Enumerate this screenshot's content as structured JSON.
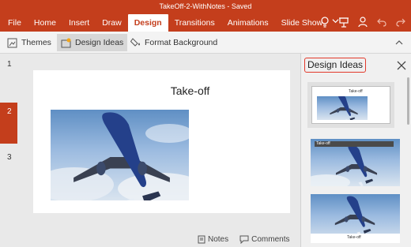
{
  "window": {
    "title": "TakeOff-2-WithNotes - Saved"
  },
  "tabs": [
    {
      "label": "File"
    },
    {
      "label": "Home"
    },
    {
      "label": "Insert"
    },
    {
      "label": "Draw"
    },
    {
      "label": "Design",
      "active": true
    },
    {
      "label": "Transitions"
    },
    {
      "label": "Animations"
    },
    {
      "label": "Slide Show"
    }
  ],
  "top_icons": [
    "lightbulb-icon",
    "presenter-icon",
    "account-icon",
    "undo-icon",
    "redo-icon"
  ],
  "ribbon": {
    "themes_label": "Themes",
    "design_ideas_label": "Design Ideas",
    "format_background_label": "Format Background"
  },
  "thumbnails": {
    "numbers": [
      "1",
      "2",
      "3"
    ],
    "selected": "2"
  },
  "slide": {
    "title": "Take-off"
  },
  "status": {
    "notes_label": "Notes",
    "comments_label": "Comments"
  },
  "pane": {
    "title": "Design Ideas",
    "designs": [
      {
        "title": "Take-off",
        "selected": true
      },
      {
        "title": "Take-off"
      },
      {
        "title": "Take-off"
      }
    ]
  },
  "colors": {
    "accent": "#c43e1c",
    "highlight": "#e2392b"
  }
}
